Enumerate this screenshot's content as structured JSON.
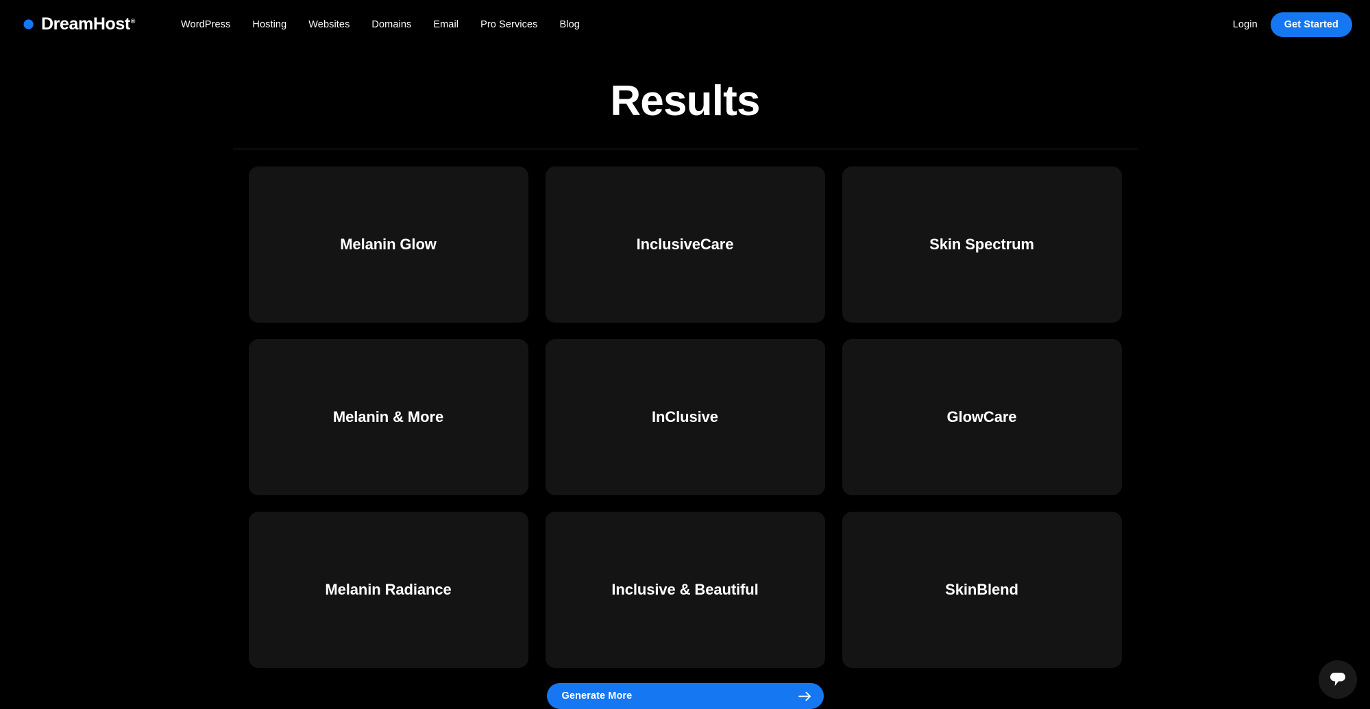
{
  "header": {
    "brand": {
      "name": "DreamHost",
      "trademark": "®",
      "logo_icon": "dreamhost-crescent-logo"
    },
    "nav_items": [
      {
        "label": "WordPress"
      },
      {
        "label": "Hosting"
      },
      {
        "label": "Websites"
      },
      {
        "label": "Domains"
      },
      {
        "label": "Email"
      },
      {
        "label": "Pro Services"
      },
      {
        "label": "Blog"
      }
    ],
    "login_label": "Login",
    "cta_label": "Get Started",
    "accent_color": "#1578f2"
  },
  "main": {
    "title": "Results",
    "cards": [
      {
        "label": "Melanin Glow"
      },
      {
        "label": "InclusiveCare"
      },
      {
        "label": "Skin Spectrum"
      },
      {
        "label": "Melanin & More"
      },
      {
        "label": "InClusive"
      },
      {
        "label": "GlowCare"
      },
      {
        "label": "Melanin Radiance"
      },
      {
        "label": "Inclusive & Beautiful"
      },
      {
        "label": "SkinBlend"
      }
    ],
    "generate_button": {
      "label": "Generate More",
      "arrow_icon": "arrow-right-icon"
    }
  },
  "chat": {
    "icon": "chat-bubble-icon"
  },
  "theme": {
    "background": "#000000",
    "card_background": "#141414",
    "accent": "#1578f2",
    "text": "#ffffff",
    "divider": "#2b2b2b"
  }
}
